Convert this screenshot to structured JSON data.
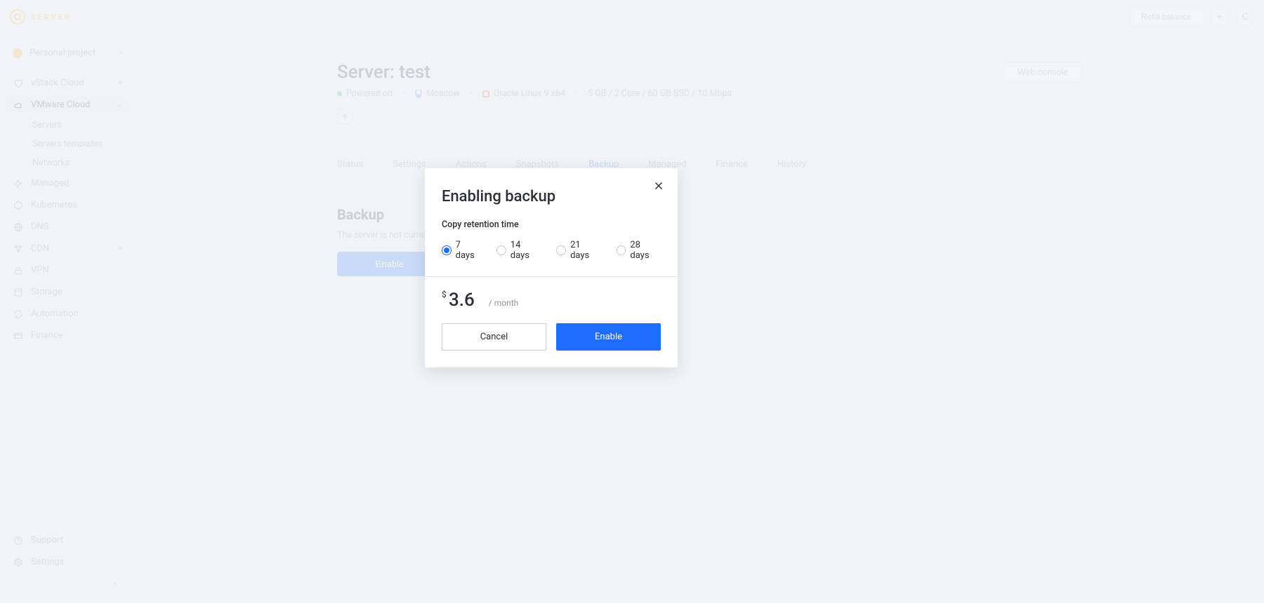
{
  "brand": "SERVER",
  "topbar": {
    "refill": "Refill balance",
    "plus": "+",
    "avatar": "C"
  },
  "project": {
    "label": "Personal project"
  },
  "sidebar": {
    "vstack": "vStack Cloud",
    "vmware": "VMware Cloud",
    "vmware_children": {
      "servers": "Servers",
      "templates": "Servers templates",
      "networks": "Networks"
    },
    "managed": "Managed",
    "kubernetes": "Kubernetes",
    "dns": "DNS",
    "cdn": "CDN",
    "vpn": "VPN",
    "storage": "Storage",
    "automation": "Automation",
    "finance": "Finance",
    "support": "Support",
    "settings": "Settings"
  },
  "page": {
    "title": "Server: test",
    "web_console": "Web console",
    "status": "Powered on",
    "location": "Moscow",
    "os": "Oracle Linux 9 x64",
    "spec": "5 GB / 2 Core / 60 GB SSD / 10 Mbps",
    "tabs": {
      "status": "Status",
      "settings": "Settings",
      "actions": "Actions",
      "snapshots": "Snapshots",
      "backup": "Backup",
      "managed": "Managed",
      "finance": "Finance",
      "history": "History"
    },
    "section_title": "Backup",
    "section_text": "The server is not currently backed up.",
    "section_btn": "Enable"
  },
  "dialog": {
    "title": "Enabling backup",
    "label": "Copy retention time",
    "opts": {
      "d7": "7 days",
      "d14": "14 days",
      "d21": "21 days",
      "d28": "28 days"
    },
    "currency": "$",
    "price": "3.6",
    "per": "/ month",
    "cancel": "Cancel",
    "enable": "Enable"
  }
}
